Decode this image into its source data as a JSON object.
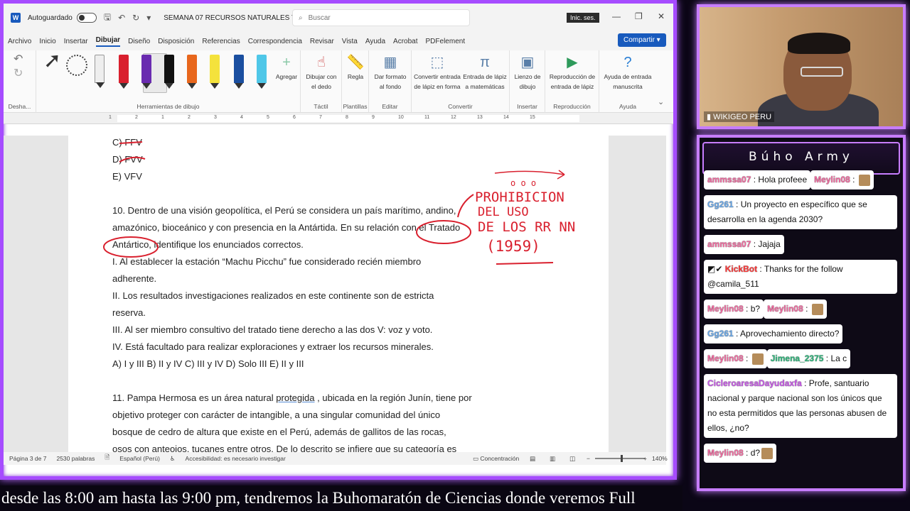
{
  "word": {
    "autosave_label": "Autoguardado",
    "doc_title": "SEMANA 07 RECURSOS NATURALES Y...",
    "search_placeholder": "Buscar",
    "signin_label": "Inic. ses.",
    "share_label": "Compartir",
    "menu_tabs": [
      "Archivo",
      "Inicio",
      "Insertar",
      "Dibujar",
      "Diseño",
      "Disposición",
      "Referencias",
      "Correspondencia",
      "Revisar",
      "Vista",
      "Ayuda",
      "Acrobat",
      "PDFelement"
    ],
    "active_tab": "Dibujar",
    "ribbon": {
      "undo_group": "Desha...",
      "draw_tools_group": "Herramientas de dibujo",
      "add_label": "Agregar",
      "draw_finger": "Dibujar con el dedo",
      "tactil": "Táctil",
      "ruler": "Regla",
      "templates": "Plantillas",
      "format_bg": "Dar formato al fondo",
      "edit": "Editar",
      "ink_shape": "Convertir entrada de lápiz en forma",
      "ink_math": "Entrada de lápiz a matemáticas",
      "convert": "Convertir",
      "canvas": "Lienzo de dibujo",
      "insert": "Insertar",
      "replay": "Reproducción de entrada de lápiz",
      "playback": "Reproducción",
      "ink_help": "Ayuda de entrada manuscrita",
      "help": "Ayuda"
    },
    "ruler_ticks": [
      "1",
      "2",
      "1",
      "2",
      "3",
      "4",
      "5",
      "6",
      "7",
      "8",
      "9",
      "10",
      "11",
      "12",
      "13",
      "14",
      "15"
    ],
    "document": {
      "lines_top": [
        "C) FFV",
        "D) FVV",
        "E) VFV"
      ],
      "q10_line1": "10. Dentro de una visión geopolítica, el Perú se considera un país marítimo, andino,",
      "q10_line2": "amazónico, bioceánico y con presencia en la Antártida. En su relación con el Tratado",
      "q10_line3": "Antártico, identifique los enunciados correctos.",
      "q10_items": [
        "I. Al establecer la estación “Machu Picchu” fue considerado recién miembro",
        "adherente.",
        "II. Los resultados investigaciones realizados en este continente son de estricta",
        "reserva.",
        "III. Al ser miembro consultivo del tratado tiene derecho a las dos V: voz y voto.",
        "IV. Está facultado para realizar exploraciones y extraer los recursos minerales.",
        "A) I y III B) II y IV C) III y IV D) Solo III E) II y III"
      ],
      "q11_line1_a": "11. Pampa Hermosa es un área natural ",
      "q11_line1_u": "protegida",
      "q11_line1_b": " , ubicada en la región Junín, tiene por",
      "q11_lines": [
        "objetivo proteger con carácter de intangible, a una singular comunidad del único",
        "bosque de cedro de altura que existe en el Perú, además de gallitos de las rocas,",
        "osos con anteojos, tucanes entre otros. De lo descrito se infiere que su categoría es"
      ]
    },
    "handwriting": {
      "line1": "PROHIBICION",
      "line2": "DEL USO",
      "line3": "DE LOS RR NN",
      "line4": "(1959)"
    },
    "status": {
      "page": "Página 3 de 7",
      "words": "2530 palabras",
      "language": "Español (Perú)",
      "accessibility": "Accesibilidad: es necesario investigar",
      "focus": "Concentración",
      "zoom": "140%"
    }
  },
  "webcam": {
    "label": "WIKIGEO PERU"
  },
  "chat": {
    "title": "Búho Army",
    "messages": [
      {
        "user": "ammssa07",
        "text": "Hola profeee",
        "color": "amm"
      },
      {
        "user": "Meylin08",
        "text": "",
        "emote": true,
        "color": "meylin"
      },
      {
        "user": "Gg261",
        "text": "Un proyecto en específico que se desarrolla en la agenda 2030?",
        "color": "gg"
      },
      {
        "user": "ammssa07",
        "text": "Jajaja",
        "color": "amm"
      },
      {
        "user": "KickBot",
        "text": "Thanks for the follow @camila_511",
        "color": "kick"
      },
      {
        "user": "Meylin08",
        "text": "b?",
        "color": "meylin"
      },
      {
        "user": "Meylin08",
        "text": "",
        "emote": true,
        "color": "meylin"
      },
      {
        "user": "Gg261",
        "text": "Aprovechamiento directo?",
        "color": "gg"
      },
      {
        "user": "Meylin08",
        "text": "",
        "emote": true,
        "color": "meylin"
      },
      {
        "user": "Jimena_2375",
        "text": "La c",
        "color": "jim"
      },
      {
        "user": "CicleroaresaDayudaxfa",
        "text": "Profe, santuario nacional y parque nacional son los únicos que no esta permitidos que las personas abusen de ellos, ¿no?",
        "color": "cic"
      },
      {
        "user": "Meylin08",
        "text": "d?",
        "emote": true,
        "color": "meylin"
      }
    ]
  },
  "ticker": {
    "text": "desde las 8:00 am hasta las 9:00 pm, tendremos la Buhomaratón de Ciencias donde veremos Full"
  }
}
